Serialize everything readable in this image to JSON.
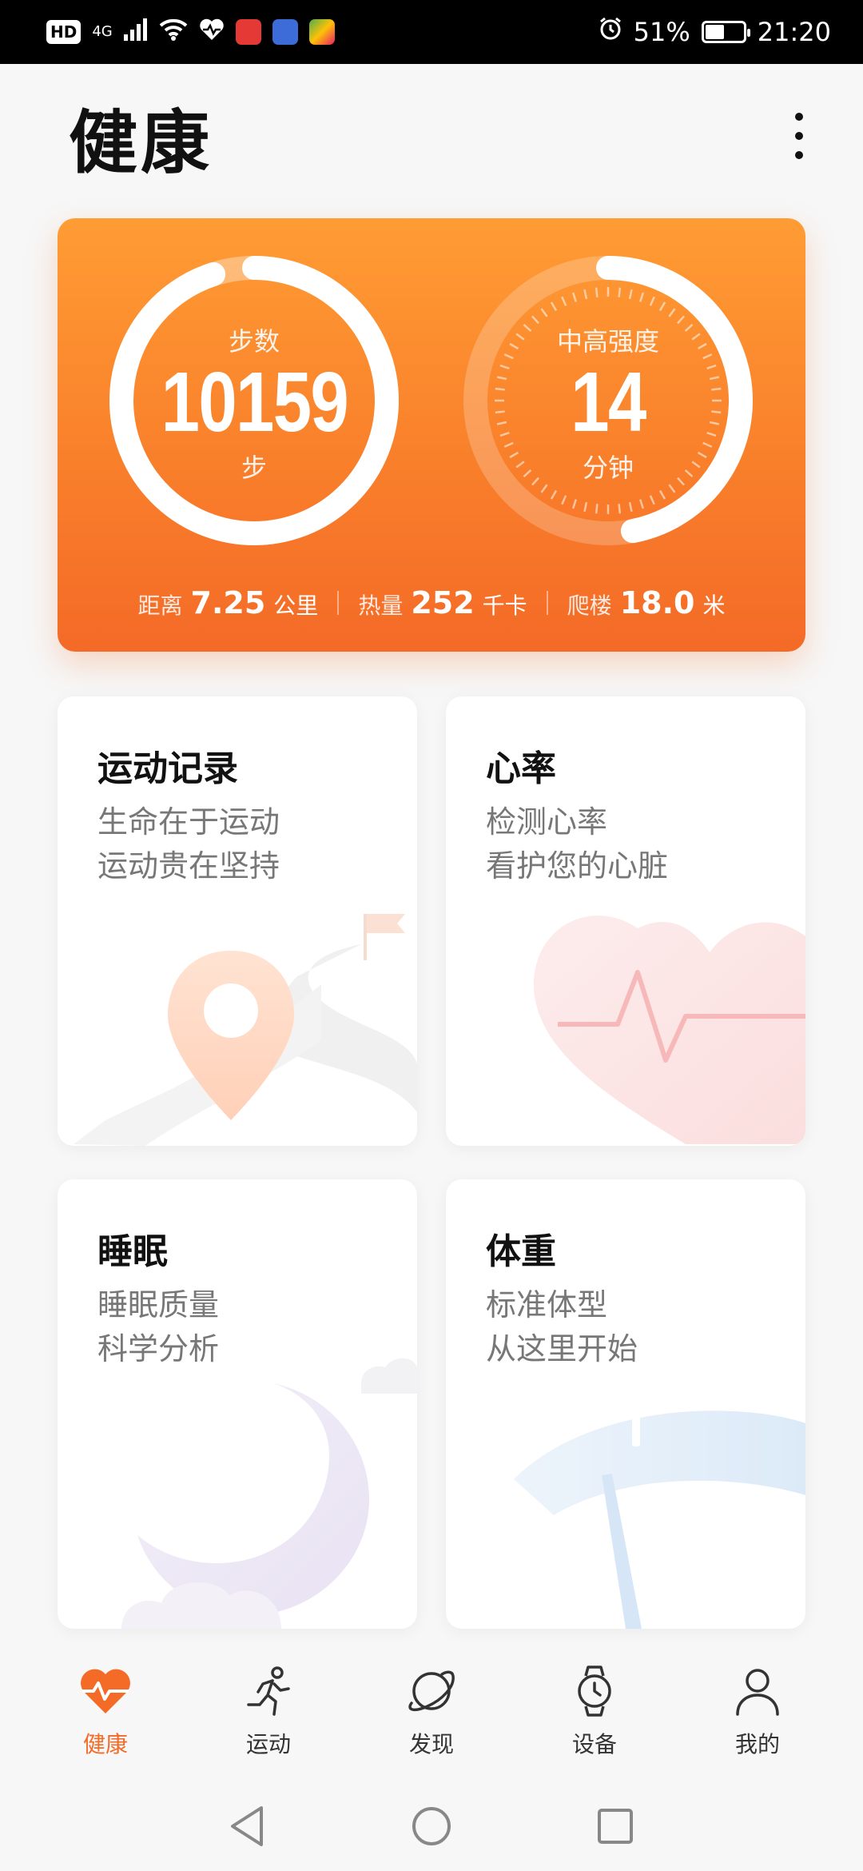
{
  "status_bar": {
    "hd": "HD",
    "network": "4G",
    "battery_percent": "51%",
    "battery_level": 0.51,
    "time": "21:20"
  },
  "header": {
    "title": "健康"
  },
  "activity": {
    "steps": {
      "label": "步数",
      "value": "10159",
      "unit": "步",
      "progress": 0.95
    },
    "intensity": {
      "label": "中高强度",
      "value": "14",
      "unit": "分钟",
      "progress": 0.47
    },
    "stats": [
      {
        "label": "距离",
        "value": "7.25",
        "unit": "公里"
      },
      {
        "label": "热量",
        "value": "252",
        "unit": "千卡"
      },
      {
        "label": "爬楼",
        "value": "18.0",
        "unit": "米"
      }
    ]
  },
  "cards": {
    "exercise": {
      "title": "运动记录",
      "line1": "生命在于运动",
      "line2": "运动贵在坚持"
    },
    "heart": {
      "title": "心率",
      "line1": "检测心率",
      "line2": "看护您的心脏"
    },
    "sleep": {
      "title": "睡眠",
      "line1": "睡眠质量",
      "line2": "科学分析"
    },
    "weight": {
      "title": "体重",
      "line1": "标准体型",
      "line2": "从这里开始"
    }
  },
  "bottom_nav": {
    "items": [
      {
        "label": "健康",
        "icon": "heart-pulse-icon",
        "active": true
      },
      {
        "label": "运动",
        "icon": "running-icon",
        "active": false
      },
      {
        "label": "发现",
        "icon": "planet-icon",
        "active": false
      },
      {
        "label": "设备",
        "icon": "watch-icon",
        "active": false
      },
      {
        "label": "我的",
        "icon": "person-icon",
        "active": false
      }
    ]
  },
  "colors": {
    "accent": "#f46a27",
    "card_top": "#ff9c34",
    "card_bottom": "#f46a27"
  }
}
